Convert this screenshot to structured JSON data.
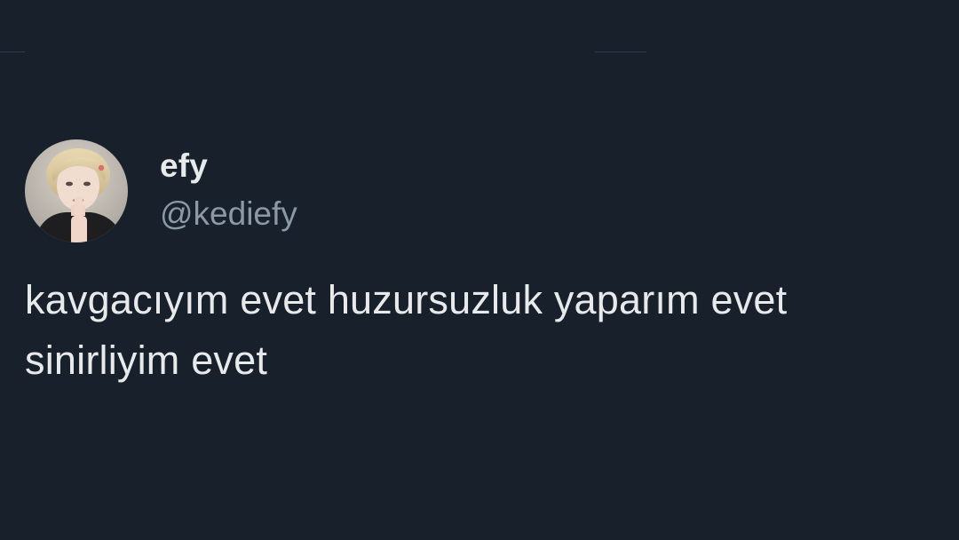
{
  "tweet": {
    "display_name": "efy",
    "handle": "@kediefy",
    "text": "kavgacıyım evet huzursuzluk yaparım evet\nsinirliyim evet"
  },
  "colors": {
    "background": "#17202b",
    "primary_text": "#e7e9ea",
    "secondary_text": "#8b98a5",
    "divider": "#2f3b47"
  }
}
